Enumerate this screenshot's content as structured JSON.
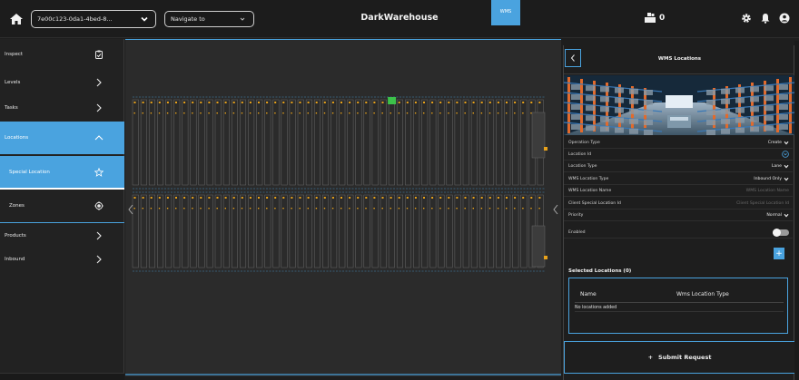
{
  "header": {
    "tenant_select": "7e00c123-0da1-4bed-8...",
    "nav_select_placeholder": "Navigate to",
    "brand": "DarkWarehouse",
    "wms_badge": "WMS",
    "count": "0"
  },
  "sidebar": {
    "items": [
      {
        "label": "Inspect",
        "icon": "clipboard-check-icon"
      },
      {
        "label": "Levels",
        "icon": "chevron-right-icon"
      },
      {
        "label": "Tasks",
        "icon": "chevron-right-icon"
      },
      {
        "label": "Locations",
        "icon": "chevron-up-icon"
      },
      {
        "label": "Special Location",
        "icon": "star-icon"
      },
      {
        "label": "Zones",
        "icon": "target-icon"
      },
      {
        "label": "Products",
        "icon": "chevron-right-icon"
      },
      {
        "label": "Inbound",
        "icon": "chevron-right-icon"
      }
    ]
  },
  "panel": {
    "title": "WMS Locations",
    "fields": [
      {
        "label": "Operation Type",
        "value": "Create",
        "kind": "select"
      },
      {
        "label": "Location Id",
        "value": "",
        "kind": "pick"
      },
      {
        "label": "Location Type",
        "value": "Lane",
        "kind": "select"
      },
      {
        "label": "WMS Location Type",
        "value": "Inbound Only",
        "kind": "select"
      },
      {
        "label": "WMS Location Name",
        "placeholder": "WMS Location Name",
        "kind": "input"
      },
      {
        "label": "Client Special Location Id",
        "placeholder": "Client Special Location Id",
        "kind": "input"
      },
      {
        "label": "Priority",
        "value": "Normal",
        "kind": "select"
      },
      {
        "label": "Enabled",
        "kind": "toggle",
        "enabled": false
      }
    ],
    "add_label": "+",
    "selected_title": "Selected Locations (0)",
    "table_headers": [
      "Name",
      "Wms Location Type"
    ],
    "empty_text": "No locations added",
    "submit_label": "Submit Request",
    "submit_icon": "+"
  },
  "colors": {
    "accent": "#4aa3df",
    "background": "#1e1e1e",
    "map_bg": "#2b2b2b",
    "selected_slot": "#3cc24a",
    "lane_marker": "#e8a21a"
  }
}
